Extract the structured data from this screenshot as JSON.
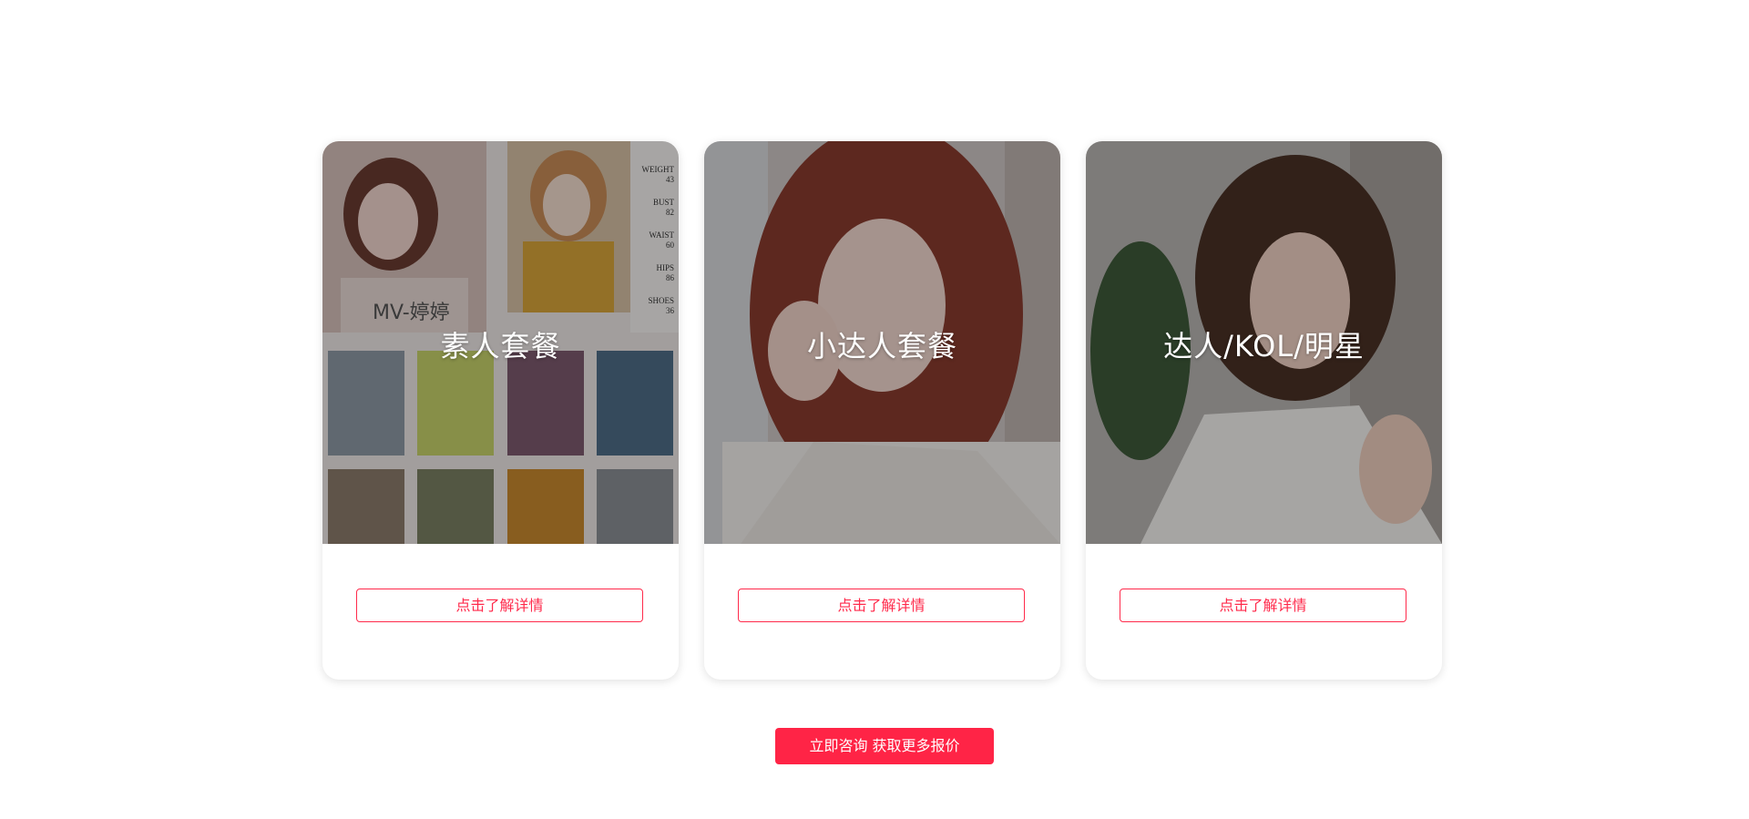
{
  "packages": [
    {
      "title": "素人套餐",
      "detail_label": "点击了解详情",
      "photo_watermark": "MV-婷婷",
      "photo_labels": [
        "WEIGHT",
        "43",
        "BUST",
        "82",
        "WAIST",
        "60",
        "HIPS",
        "86",
        "SHOES",
        "36"
      ]
    },
    {
      "title": "小达人套餐",
      "detail_label": "点击了解详情"
    },
    {
      "title": "达人/KOL/明星",
      "detail_label": "点击了解详情"
    }
  ],
  "consult_button": "立即咨询 获取更多报价",
  "colors": {
    "accent": "#ff2446",
    "outline": "#ff2a4b"
  }
}
